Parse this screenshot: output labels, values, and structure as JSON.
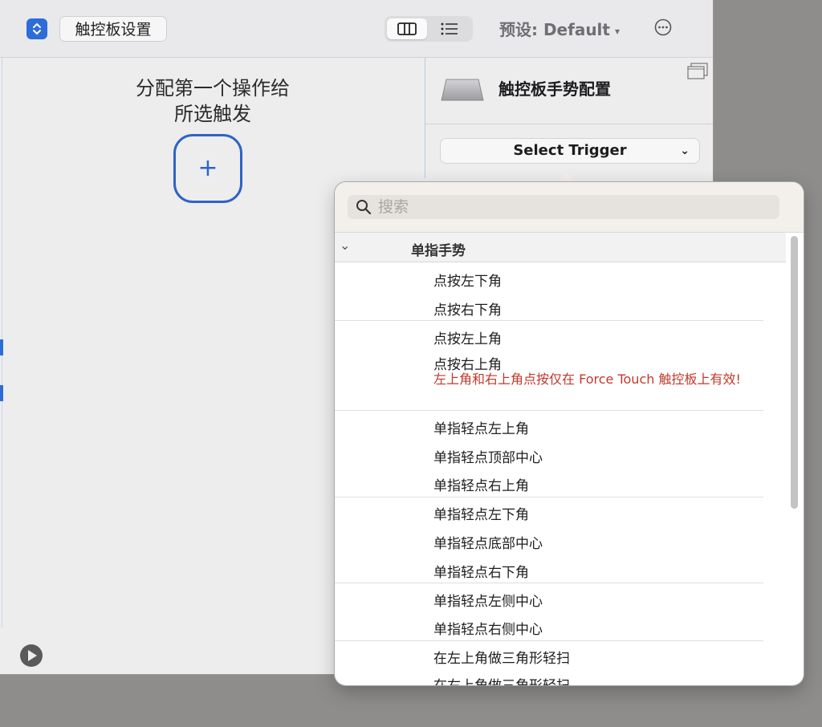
{
  "toolbar": {
    "trackpad_settings_button": "触控板设置",
    "preset_label": "预设: Default"
  },
  "main": {
    "assign_line1": "分配第一个操作给",
    "assign_line2": "所选触发",
    "add_symbol": "+"
  },
  "inspector": {
    "title": "触控板手势配置",
    "select_trigger": "Select Trigger"
  },
  "popover": {
    "search_placeholder": "搜索",
    "group": "单指手势",
    "items": [
      "点按左下角",
      "点按右下角",
      "点按左上角",
      "点按右上角",
      "单指轻点左上角",
      "单指轻点顶部中心",
      "单指轻点右上角",
      "单指轻点左下角",
      "单指轻点底部中心",
      "单指轻点右下角",
      "单指轻点左侧中心",
      "单指轻点右侧中心",
      "在左上角做三角形轻扫",
      "在右上角做三角形轻扫"
    ],
    "note": "左上角和右上角点按仅在 Force Touch 触控板上有效!"
  },
  "colors": {
    "accent": "#2f63c6",
    "warning": "#c0392b"
  }
}
